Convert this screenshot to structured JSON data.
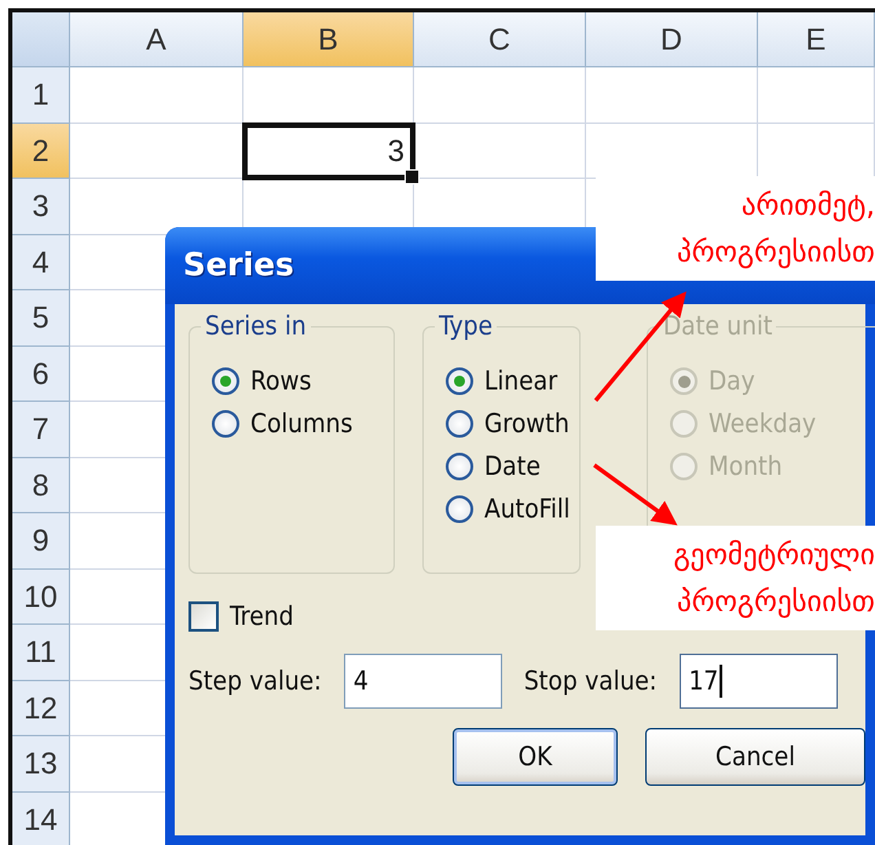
{
  "sheet": {
    "columns": [
      {
        "label": "A",
        "selected": false
      },
      {
        "label": "B",
        "selected": true
      },
      {
        "label": "C",
        "selected": false
      },
      {
        "label": "D",
        "selected": false
      },
      {
        "label": "E",
        "selected": false
      }
    ],
    "rows": [
      {
        "label": "1",
        "selected": false
      },
      {
        "label": "2",
        "selected": true
      },
      {
        "label": "3",
        "selected": false
      },
      {
        "label": "4",
        "selected": false
      },
      {
        "label": "5",
        "selected": false
      },
      {
        "label": "6",
        "selected": false
      },
      {
        "label": "7",
        "selected": false
      },
      {
        "label": "8",
        "selected": false
      },
      {
        "label": "9",
        "selected": false
      },
      {
        "label": "10",
        "selected": false
      },
      {
        "label": "11",
        "selected": false
      },
      {
        "label": "12",
        "selected": false
      },
      {
        "label": "13",
        "selected": false
      },
      {
        "label": "14",
        "selected": false
      }
    ],
    "active_cell": {
      "value": "3"
    }
  },
  "dialog": {
    "title": "Series",
    "groups": [
      {
        "title": "Series in",
        "disabled": false,
        "options": [
          {
            "label": "Rows",
            "selected": true
          },
          {
            "label": "Columns",
            "selected": false
          }
        ]
      },
      {
        "title": "Type",
        "disabled": false,
        "options": [
          {
            "label": "Linear",
            "selected": true
          },
          {
            "label": "Growth",
            "selected": false
          },
          {
            "label": "Date",
            "selected": false
          },
          {
            "label": "AutoFill",
            "selected": false
          }
        ]
      },
      {
        "title": "Date unit",
        "disabled": true,
        "options": [
          {
            "label": "Day",
            "selected": true
          },
          {
            "label": "Weekday",
            "selected": false
          },
          {
            "label": "Month",
            "selected": false
          }
        ]
      }
    ],
    "trend": {
      "label": "Trend",
      "checked": false
    },
    "fields": [
      {
        "label": "Step value:",
        "value": "4",
        "focused": false
      },
      {
        "label": "Stop value:",
        "value": "17",
        "focused": true
      }
    ],
    "buttons": [
      {
        "label": "OK",
        "default": true
      },
      {
        "label": "Cancel",
        "default": false
      }
    ]
  },
  "annotations": [
    {
      "text": "არითმეტ,\nპროგრესიისთ"
    },
    {
      "text": "გეომეტრიული\nპროგრესიისთ"
    }
  ]
}
